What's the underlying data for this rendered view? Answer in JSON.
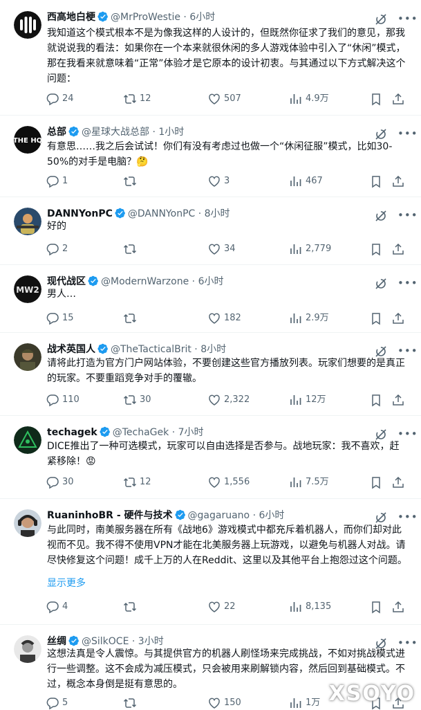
{
  "tweets": [
    {
      "name": "西高地白梗",
      "handle": "@MrProWestie",
      "time": "6小时",
      "text": "我知道这个模式根本不是为像我这样的人设计的，但既然你征求了我们的意见，那我就说说我的看法：如果你在一个本来就很休闲的多人游戏体验中引入了“休闲”模式，那在我看来就意味着“正常”体验才是它原本的设计初衷。与其通过以下方式解决这个问题：",
      "replies": "24",
      "retweets": "12",
      "likes": "507",
      "views": "4.9万"
    },
    {
      "name": "总部",
      "handle": "@星球大战总部",
      "time": "1小时",
      "text": "有意思……我之后会试试！你们有没有考虑过也做一个“休闲征服”模式，比如30-50%的对手是电脑？🤔",
      "replies": "1",
      "retweets": "",
      "likes": "3",
      "views": "467"
    },
    {
      "name": "DANNYonPC",
      "handle": "@DANNYonPC",
      "time": "8小时",
      "text": "好的",
      "replies": "2",
      "retweets": "",
      "likes": "34",
      "views": "2,779"
    },
    {
      "name": "现代战区",
      "handle": "@ModernWarzone",
      "time": "6小时",
      "text": "男人…",
      "replies": "15",
      "retweets": "",
      "likes": "182",
      "views": "2.9万"
    },
    {
      "name": "战术英国人",
      "handle": "@TheTacticalBrit",
      "time": "8小时",
      "text": "请将此打造为官方门户网站体验，不要创建这些官方播放列表。玩家们想要的是真正的玩家。不要重蹈竞争对手的覆辙。",
      "replies": "110",
      "retweets": "30",
      "likes": "2,322",
      "views": "12万"
    },
    {
      "name": "techagek",
      "handle": "@TechaGek",
      "time": "7小时",
      "text": "DICE推出了一种可选模式，玩家可以自由选择是否参与。战地玩家：我不喜欢，赶紧移除！😡",
      "replies": "30",
      "retweets": "12",
      "likes": "1,556",
      "views": "7.5万"
    },
    {
      "name": "RuaninhoBR - 硬件与技术",
      "handle": "@gagaruano",
      "time": "6小时",
      "text": "与此同时，南美服务器在所有《战地6》游戏模式中都充斥着机器人，而你们却对此视而不见。我不得不使用VPN才能在北美服务器上玩游戏，以避免与机器人对战。请尽快修复这个问题！成千上万的人在Reddit、这里以及其他平台上抱怨过这个问题。",
      "show_more": "显示更多",
      "replies": "4",
      "retweets": "",
      "likes": "22",
      "views": "8,135"
    },
    {
      "name": "丝绸",
      "handle": "@SilkOCE",
      "time": "3小时",
      "text": "这想法真是令人震惊。与其提供官方的机器人刷怪场来完成挑战，不如对挑战模式进行一些调整。这不会成为减压模式，只会被用来刷解锁内容，然后回到基础模式。不过，概念本身倒是挺有意思的。",
      "replies": "5",
      "retweets": "",
      "likes": "150",
      "views": "1万"
    }
  ],
  "separator": "·",
  "avatar_labels": {
    "hq": "THE HQ",
    "mw": "MW2"
  },
  "watermark": "XSOYO",
  "icons": [
    "verified-badge-icon",
    "grok-icon",
    "more-icon",
    "reply-icon",
    "retweet-icon",
    "like-icon",
    "views-icon",
    "bookmark-icon",
    "share-icon"
  ],
  "colors": {
    "text": "#0f1419",
    "secondary": "#536471",
    "link": "#1d9bf0",
    "verified": "#1d9bf0",
    "border": "#eff3f4"
  }
}
